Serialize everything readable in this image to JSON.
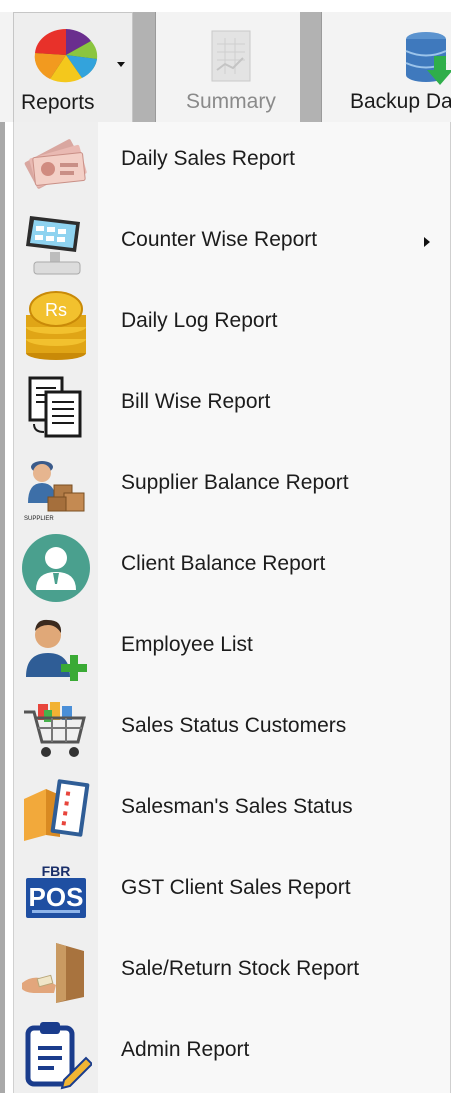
{
  "ribbon": {
    "reports": {
      "label": "Reports",
      "icon": "pie-chart-icon"
    },
    "summary": {
      "label": "Summary",
      "icon": "document-icon",
      "disabled": true
    },
    "backup": {
      "label": "Backup Da",
      "icon": "database-icon"
    }
  },
  "menu": {
    "items": [
      {
        "label": "Daily Sales Report",
        "icon": "cash-icon"
      },
      {
        "label": "Counter Wise Report",
        "icon": "pos-terminal-icon",
        "has_submenu": true
      },
      {
        "label": "Daily Log Report",
        "icon": "coins-icon",
        "icon_text": "Rs"
      },
      {
        "label": "Bill Wise Report",
        "icon": "documents-icon"
      },
      {
        "label": "Supplier Balance Report",
        "icon": "supplier-icon",
        "icon_text": "SUPPLIER"
      },
      {
        "label": "Client Balance Report",
        "icon": "client-avatar-icon"
      },
      {
        "label": "Employee List",
        "icon": "add-user-icon"
      },
      {
        "label": "Sales Status Customers",
        "icon": "shopping-cart-icon"
      },
      {
        "label": "Salesman's Sales Status",
        "icon": "checklist-box-icon"
      },
      {
        "label": "GST Client Sales Report",
        "icon": "fbr-pos-icon",
        "icon_text_top": "FBR",
        "icon_text_main": "POS"
      },
      {
        "label": "Sale/Return Stock Report",
        "icon": "package-hand-icon"
      },
      {
        "label": "Admin Report",
        "icon": "clipboard-pen-icon"
      }
    ]
  },
  "colors": {
    "menu_bg": "#f8f8f8",
    "icon_column_bg": "#efefef",
    "text": "#1c1c1c",
    "disabled_text": "#8a8a8a"
  }
}
